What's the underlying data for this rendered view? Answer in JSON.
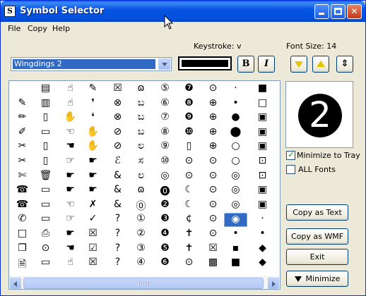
{
  "window": {
    "title": "Symbol Selector",
    "app_icon_glyph": "S"
  },
  "menu": [
    "File",
    "Copy",
    "Help"
  ],
  "toolbar": {
    "keystroke_label": "Keystroke: v",
    "font_size_label": "Font Size: 14",
    "font_name": "Wingdings 2",
    "text_color": "#000000",
    "bold_label": "B",
    "italic_label": "I",
    "fit_glyph": "⇕"
  },
  "grid": {
    "selected_index": 108,
    "rows": [
      [
        "",
        "▤",
        "☝",
        "✎",
        "☒",
        "ɷ",
        "⑤",
        "❼",
        "⊙",
        "·",
        "■"
      ],
      [
        "✎",
        "▥",
        "☝",
        "❜",
        "⊗",
        "ಬ",
        "⑥",
        "❽",
        "⊕",
        "•",
        "□"
      ],
      [
        "✏",
        "▯",
        "✋",
        "❛",
        "⊗",
        "ಬ",
        "⑦",
        "❾",
        "⊕",
        "●",
        "▣"
      ],
      [
        "✐",
        "▭",
        "☜",
        "✋",
        "⊘",
        "ಬ",
        "⑧",
        "❿",
        "⊕",
        "⬤",
        "▣"
      ],
      [
        "✂",
        "▯",
        "☚",
        "✋",
        "⊘",
        "ಲ",
        "⑨",
        "▯",
        "⊕",
        "○",
        "▣"
      ],
      [
        "✂",
        "▯",
        "☞",
        "☛",
        "ℰ",
        "ಸ",
        "⑩",
        "⊙",
        "⊙",
        "○",
        "⊡"
      ],
      [
        "✄",
        "🗑",
        "☛",
        "☛",
        "&",
        "ಲ",
        "◎",
        "⊙",
        "⊙",
        "◎",
        "⊡"
      ],
      [
        "☎",
        "▭",
        "☛",
        "☛",
        "&",
        "ɷ",
        "⓿",
        "☾",
        "⊙",
        "◎",
        "▣"
      ],
      [
        "☎",
        "▭",
        "☜",
        "✗",
        "&",
        "⓪",
        "❷",
        "☾",
        "⊙",
        "◎",
        "▣"
      ],
      [
        "✆",
        "▭",
        "☞",
        "✓",
        "?",
        "①",
        "❸",
        "¢",
        "⊙",
        "◉",
        "·"
      ],
      [
        "□",
        "⎙",
        "☛",
        "☒",
        "?",
        "②",
        "❹",
        "✝",
        "⊙",
        "•",
        "•"
      ],
      [
        "❐",
        "⊙",
        "☚",
        "☑",
        "?",
        "③",
        "❺",
        "✝",
        "☒",
        "▪",
        "◆"
      ],
      [
        "🗎",
        "▭",
        "☝",
        "☒",
        "?",
        "④",
        "❻",
        "⊙",
        "▩",
        "■",
        "◆"
      ]
    ]
  },
  "preview": {
    "glyph": "2"
  },
  "options": {
    "minimize_to_tray": {
      "label": "Minimize to Tray",
      "checked": true
    },
    "all_fonts": {
      "label": "ALL Fonts",
      "checked": false
    }
  },
  "actions": {
    "copy_text": "Copy as Text",
    "copy_wmf": "Copy as WMF",
    "exit": "Exit",
    "minimize": "Minimize"
  }
}
